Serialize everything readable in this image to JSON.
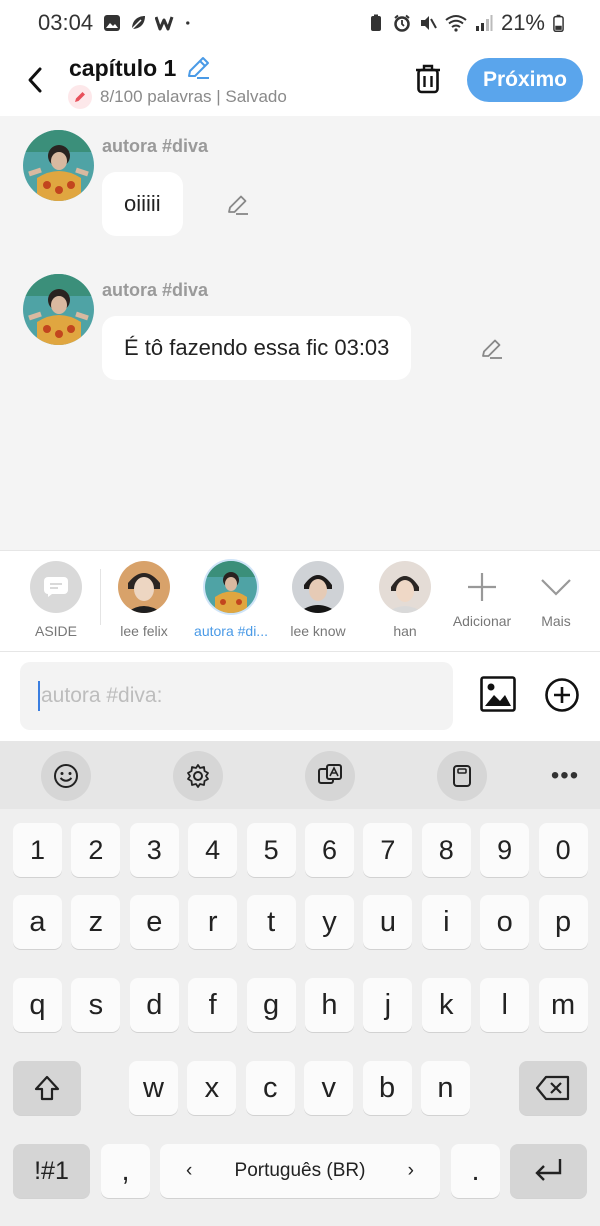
{
  "status_bar": {
    "time": "03:04",
    "battery": "21%"
  },
  "header": {
    "title": "capítulo 1",
    "subtitle": "8/100 palavras | Salvado",
    "next_label": "Próximo"
  },
  "messages": [
    {
      "author": "autora #diva",
      "text": "oiiiii"
    },
    {
      "author": "autora #diva",
      "text": "É tô fazendo essa fic 03:03"
    }
  ],
  "characters": [
    {
      "label": "ASIDE",
      "active": false
    },
    {
      "label": "lee felix",
      "active": false
    },
    {
      "label": "autora #di...",
      "active": true
    },
    {
      "label": "lee know",
      "active": false
    },
    {
      "label": "han",
      "active": false
    }
  ],
  "char_actions": {
    "add_label": "Adicionar",
    "more_label": "Mais"
  },
  "input": {
    "placeholder": "autora #diva:"
  },
  "keyboard": {
    "more_label": "•••",
    "row_numbers": [
      "1",
      "2",
      "3",
      "4",
      "5",
      "6",
      "7",
      "8",
      "9",
      "0"
    ],
    "row1": [
      "a",
      "z",
      "e",
      "r",
      "t",
      "y",
      "u",
      "i",
      "o",
      "p"
    ],
    "row2": [
      "q",
      "s",
      "d",
      "f",
      "g",
      "h",
      "j",
      "k",
      "l",
      "m"
    ],
    "row3": [
      "w",
      "x",
      "c",
      "v",
      "b",
      "n"
    ],
    "symbols_label": "!#1",
    "comma_label": ",",
    "language_label": "Português (BR)",
    "period_label": "."
  },
  "colors": {
    "accent": "#5aa5ec",
    "active_char": "#4a9ae6"
  }
}
